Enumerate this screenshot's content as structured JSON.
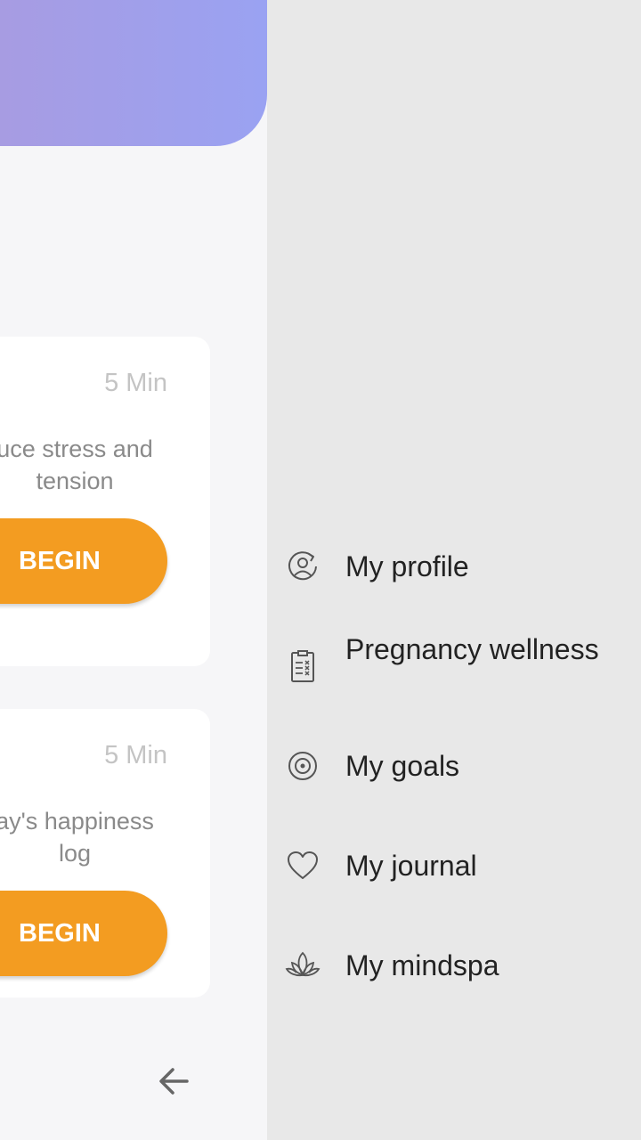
{
  "cards": [
    {
      "duration": "5 Min",
      "desc_line1": "uce stress and",
      "desc_line2": "tension",
      "button": "BEGIN"
    },
    {
      "duration": "5 Min",
      "desc_line1": "ay's happiness",
      "desc_line2": "log",
      "button": "BEGIN"
    }
  ],
  "drawer": {
    "items": [
      {
        "label": "My profile",
        "icon": "profile-sync-icon"
      },
      {
        "label": "Pregnancy wellness",
        "icon": "clipboard-checklist-icon"
      },
      {
        "label": "My goals",
        "icon": "target-icon"
      },
      {
        "label": "My journal",
        "icon": "heart-icon"
      },
      {
        "label": "My mindspa",
        "icon": "lotus-icon"
      }
    ]
  },
  "colors": {
    "accent": "#f39c21",
    "drawer_bg": "#e8e8e8",
    "banner_start": "#a99be0",
    "banner_end": "#9aa2f2"
  }
}
